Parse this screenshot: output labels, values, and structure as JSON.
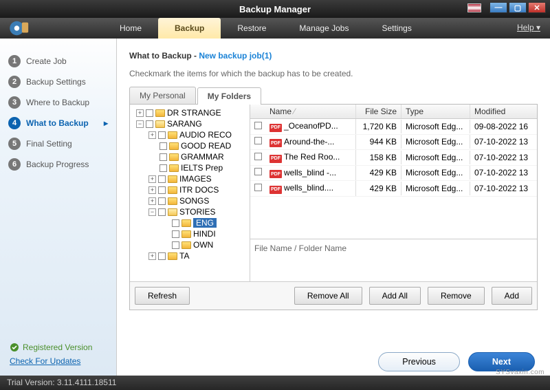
{
  "window": {
    "title": "Backup Manager"
  },
  "menu": {
    "items": [
      "Home",
      "Backup",
      "Restore",
      "Manage Jobs",
      "Settings"
    ],
    "active": "Backup",
    "help": "Help"
  },
  "sidebar": {
    "steps": [
      {
        "num": "1",
        "label": "Create Job"
      },
      {
        "num": "2",
        "label": "Backup Settings"
      },
      {
        "num": "3",
        "label": "Where to Backup"
      },
      {
        "num": "4",
        "label": "What to Backup"
      },
      {
        "num": "5",
        "label": "Final Setting"
      },
      {
        "num": "6",
        "label": "Backup Progress"
      }
    ],
    "active_index": 3,
    "registered": "Registered Version",
    "check_updates": "Check For Updates"
  },
  "page": {
    "heading_prefix": "What to Backup - ",
    "heading_job": "New backup job(1)",
    "subhead": "Checkmark the items for which the backup has to be created.",
    "tabs": [
      "My Personal",
      "My Folders"
    ],
    "active_tab": 1
  },
  "tree": [
    {
      "indent": 38,
      "exp": "+",
      "folder": true,
      "label": "DR STRANGE"
    },
    {
      "indent": 38,
      "exp": "−",
      "folder": true,
      "open": true,
      "label": "SARANG"
    },
    {
      "indent": 56,
      "exp": "+",
      "folder": true,
      "label": "AUDIO RECO"
    },
    {
      "indent": 56,
      "exp": "",
      "folder": true,
      "label": "GOOD READ"
    },
    {
      "indent": 56,
      "exp": "",
      "folder": true,
      "label": "GRAMMAR "
    },
    {
      "indent": 56,
      "exp": "",
      "folder": true,
      "label": "IELTS Prep"
    },
    {
      "indent": 56,
      "exp": "+",
      "folder": true,
      "label": "IMAGES"
    },
    {
      "indent": 56,
      "exp": "+",
      "folder": true,
      "label": "ITR DOCS"
    },
    {
      "indent": 56,
      "exp": "+",
      "folder": true,
      "label": "SONGS"
    },
    {
      "indent": 56,
      "exp": "−",
      "folder": true,
      "open": true,
      "label": "STORIES"
    },
    {
      "indent": 74,
      "exp": "",
      "folder": true,
      "label": "ENG",
      "selected": true
    },
    {
      "indent": 74,
      "exp": "",
      "folder": true,
      "label": "HINDI"
    },
    {
      "indent": 74,
      "exp": "",
      "folder": true,
      "label": "OWN"
    },
    {
      "indent": 56,
      "exp": "+",
      "folder": true,
      "label": "TA"
    }
  ],
  "file_headers": {
    "name": "Name",
    "size": "File Size",
    "type": "Type",
    "mod": "Modified"
  },
  "files": [
    {
      "name": "_OceanofPD...",
      "size": "1,720 KB",
      "type": "Microsoft Edg...",
      "mod": "09-08-2022 16"
    },
    {
      "name": "Around-the-...",
      "size": "944 KB",
      "type": "Microsoft Edg...",
      "mod": "07-10-2022 13"
    },
    {
      "name": "The Red Roo...",
      "size": "158 KB",
      "type": "Microsoft Edg...",
      "mod": "07-10-2022 13"
    },
    {
      "name": "wells_blind -...",
      "size": "429 KB",
      "type": "Microsoft Edg...",
      "mod": "07-10-2022 13"
    },
    {
      "name": "wells_blind....",
      "size": "429 KB",
      "type": "Microsoft Edg...",
      "mod": "07-10-2022 13"
    }
  ],
  "selection_label": "File Name / Folder Name",
  "buttons": {
    "refresh": "Refresh",
    "remove_all": "Remove All",
    "add_all": "Add All",
    "remove": "Remove",
    "add": "Add",
    "prev": "Previous",
    "next": "Next"
  },
  "statusbar": "Trial Version: 3.11.4111.18511",
  "watermark": "SYSvaxin.com"
}
